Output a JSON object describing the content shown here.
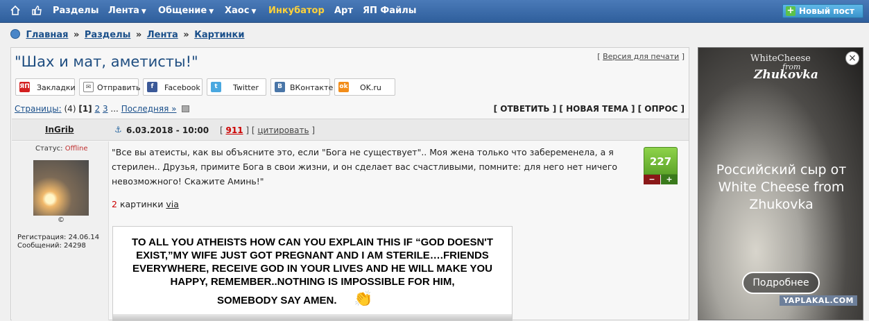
{
  "topnav": {
    "home_icon": "home-icon",
    "like_icon": "thumbs-up-icon",
    "items": [
      {
        "label": "Разделы",
        "dropdown": false
      },
      {
        "label": "Лента",
        "dropdown": true
      },
      {
        "label": "Общение",
        "dropdown": true
      },
      {
        "label": "Хаос",
        "dropdown": true
      },
      {
        "label": "Инкубатор",
        "dropdown": false,
        "highlight": "#ffd23a"
      },
      {
        "label": "Арт",
        "dropdown": false
      },
      {
        "label": "ЯП Файлы",
        "dropdown": false
      }
    ],
    "new_post_label": "Новый пост"
  },
  "breadcrumbs": [
    "Главная",
    "Разделы",
    "Лента",
    "Картинки"
  ],
  "topic": {
    "title": "\"Шах и мат, аметисты!\"",
    "print_label": "Версия для печати"
  },
  "share": [
    {
      "label": "Закладки",
      "icon": "yap-icon",
      "color": "#d32020"
    },
    {
      "label": "Отправить",
      "icon": "mail-icon",
      "color": "#888888"
    },
    {
      "label": "Facebook",
      "icon": "facebook-icon",
      "color": "#3b5998"
    },
    {
      "label": "Twitter",
      "icon": "twitter-icon",
      "color": "#4aa8e0"
    },
    {
      "label": "ВКонтакте",
      "icon": "vk-icon",
      "color": "#4a76a8"
    },
    {
      "label": "OK.ru",
      "icon": "ok-icon",
      "color": "#f28d1a"
    }
  ],
  "pagination": {
    "label": "Страницы:",
    "total": "(4)",
    "current": "[1]",
    "p2": "2",
    "p3": "3",
    "ellipsis": "...",
    "last": "Последняя »"
  },
  "actions": "[ ОТВЕТИТЬ ] [ НОВАЯ ТЕМА ] [ ОПРОС ]",
  "post": {
    "author": "InGrib",
    "date": "6.03.2018 - 10:00",
    "number": "911",
    "quote_label": "цитировать",
    "status_label": "Статус:",
    "status_value": "Offline",
    "copyright": "©",
    "reg_label": "Регистрация: 24.06.14",
    "posts_label": "Сообщений: 24298",
    "text": "\"Все вы атеисты, как вы объясните это, если \"Бога не существует\".. Моя жена только что забеременела, а я стерилен.. Друзья, примите Бога в свои жизни, и он сделает вас счастливыми, помните: для него нет ничего невозможного! Скажите Аминь!\"",
    "pics_count": "2",
    "pics_label": "картинки",
    "via_label": "via",
    "rating": "227",
    "rating_minus": "−",
    "rating_plus": "+"
  },
  "meme": {
    "text": "TO ALL YOU ATHEISTS HOW CAN YOU EXPLAIN THIS IF “GOD DOESN'T EXIST,”MY WIFE JUST GOT PREGNANT AND I AM STERILE….FRIENDS EVERYWHERE, RECEIVE GOD IN YOUR LIVES AND HE WILL MAKE YOU HAPPY, REMEMBER..NOTHING IS IMPOSSIBLE FOR HIM,",
    "last_line": "SOMEBODY SAY AMEN."
  },
  "ad": {
    "brand_line1": "WhiteCheese",
    "brand_line2": "from",
    "brand_line3": "Zhukovka",
    "headline": "Российский сыр от White Cheese from Zhukovka",
    "button": "Подробнее",
    "watermark": "YAPLAKAL.COM",
    "close": "×"
  }
}
